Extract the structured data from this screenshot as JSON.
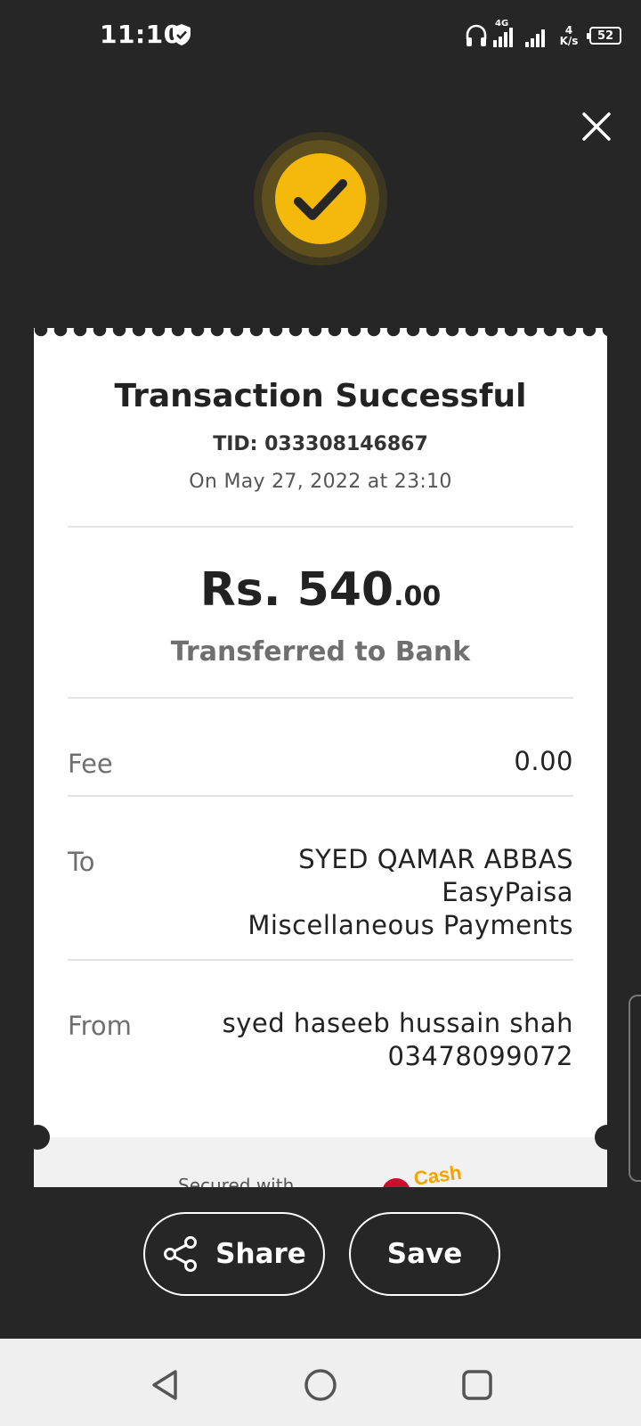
{
  "status_bar": {
    "time": "11:10",
    "network_type": "4G",
    "speed_value": "4",
    "speed_unit": "K/s",
    "battery": "52"
  },
  "receipt": {
    "title": "Transaction Successful",
    "tid": "TID: 033308146867",
    "date": "On May 27, 2022 at 23:10",
    "amount_main": "Rs. 540",
    "amount_cents": ".00",
    "transaction_type": "Transferred to Bank",
    "fee_label": "Fee",
    "fee_value": "0.00",
    "to_label": "To",
    "to_lines": [
      "SYED QAMAR ABBAS",
      "EasyPaisa",
      "Miscellaneous Payments"
    ],
    "from_label": "From",
    "from_lines": [
      "syed haseeb hussain shah",
      "03478099072"
    ],
    "powered_by": "Secured with",
    "logo_text": "Cash"
  },
  "actions": {
    "share_label": "Share",
    "save_label": "Save"
  },
  "colors": {
    "background": "#262626",
    "accent": "#f5b90c",
    "card": "#ffffff",
    "muted_text": "#6f6f6f"
  }
}
